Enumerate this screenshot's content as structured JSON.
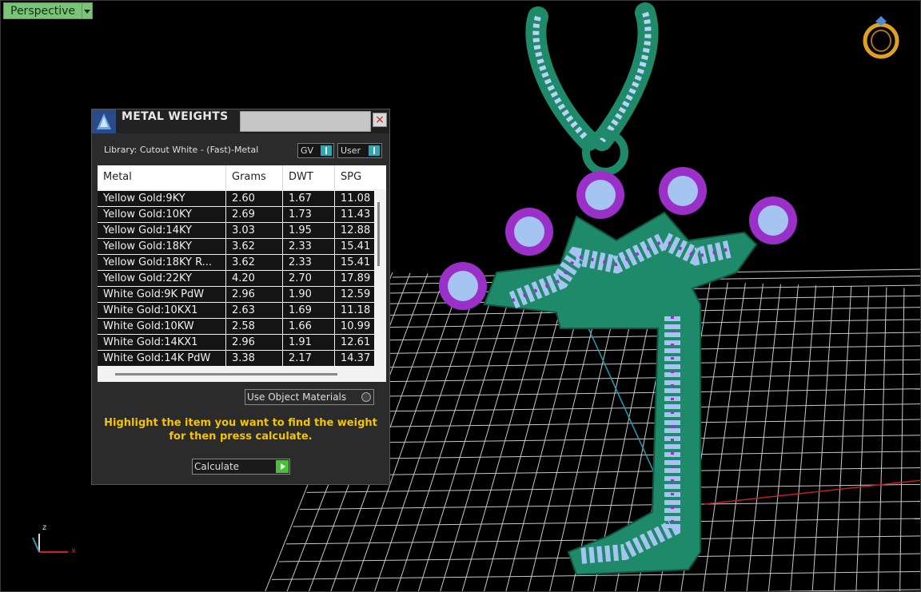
{
  "viewport": {
    "label": "Perspective"
  },
  "panel": {
    "title": "METAL WEIGHTS",
    "close": "×",
    "library": "Library: Cutout White - (Fast)-Metal",
    "toggle_gv": "GV",
    "toggle_user": "User",
    "columns": [
      "Metal",
      "Grams",
      "DWT",
      "SPG"
    ],
    "rows": [
      {
        "metal": "Yellow Gold:9KY",
        "grams": "2.60",
        "dwt": "1.67",
        "spg": "11.08"
      },
      {
        "metal": "Yellow Gold:10KY",
        "grams": "2.69",
        "dwt": "1.73",
        "spg": "11.43"
      },
      {
        "metal": "Yellow Gold:14KY",
        "grams": "3.03",
        "dwt": "1.95",
        "spg": "12.88"
      },
      {
        "metal": "Yellow Gold:18KY",
        "grams": "3.62",
        "dwt": "2.33",
        "spg": "15.41"
      },
      {
        "metal": "Yellow Gold:18KY R...",
        "grams": "3.62",
        "dwt": "2.33",
        "spg": "15.41"
      },
      {
        "metal": "Yellow Gold:22KY",
        "grams": "4.20",
        "dwt": "2.70",
        "spg": "17.89"
      },
      {
        "metal": "White Gold:9K PdW",
        "grams": "2.96",
        "dwt": "1.90",
        "spg": "12.59"
      },
      {
        "metal": "White Gold:10KX1",
        "grams": "2.63",
        "dwt": "1.69",
        "spg": "11.18"
      },
      {
        "metal": "White Gold:10KW",
        "grams": "2.58",
        "dwt": "1.66",
        "spg": "10.99"
      },
      {
        "metal": "White Gold:14KX1",
        "grams": "2.96",
        "dwt": "1.91",
        "spg": "12.61"
      },
      {
        "metal": "White Gold:14K PdW",
        "grams": "3.38",
        "dwt": "2.17",
        "spg": "14.37"
      }
    ],
    "use_object_materials": "Use Object Materials",
    "hint_line1": "Highlight the item you want to find the weight",
    "hint_line2": "for then press calculate.",
    "calculate": "Calculate"
  },
  "axis": {
    "z": "z",
    "x": "x"
  },
  "colors": {
    "metal_green": "#1f8a6a",
    "prong_purple": "#9b30c8",
    "stone_blue": "#a6c4f2",
    "hint_yellow": "#f4c400",
    "grid": "#cfcfcf"
  }
}
